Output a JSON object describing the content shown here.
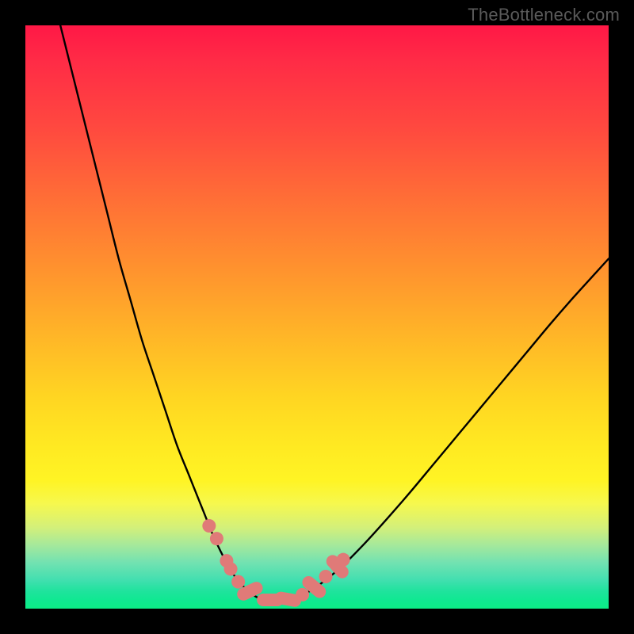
{
  "watermark": {
    "text": "TheBottleneck.com"
  },
  "colors": {
    "frame": "#000000",
    "curve_stroke": "#000000",
    "marker_fill": "#e07a78",
    "marker_stroke": "#d66e6c"
  },
  "chart_data": {
    "type": "line",
    "title": "",
    "xlabel": "",
    "ylabel": "",
    "xlim": [
      0,
      100
    ],
    "ylim": [
      0,
      100
    ],
    "grid": false,
    "legend": false,
    "series": [
      {
        "name": "bottleneck-curve",
        "x": [
          6,
          8,
          10,
          12,
          14,
          16,
          18,
          20,
          22,
          24,
          26,
          28,
          30,
          31,
          32,
          33,
          34,
          35,
          36,
          37,
          38,
          39,
          40,
          41,
          42,
          44,
          46,
          48,
          50,
          54,
          58,
          62,
          66,
          70,
          74,
          78,
          82,
          86,
          90,
          94,
          98,
          100
        ],
        "y": [
          100,
          92,
          84,
          76,
          68,
          60,
          53,
          46,
          40,
          34,
          28,
          23,
          18,
          15.5,
          13,
          10.8,
          8.8,
          7,
          5.4,
          4.2,
          3.2,
          2.4,
          1.8,
          1.4,
          1.3,
          1.4,
          1.8,
          2.6,
          3.8,
          7,
          11,
          15.4,
          20,
          24.8,
          29.6,
          34.4,
          39.2,
          44,
          48.8,
          53.4,
          57.8,
          60
        ]
      }
    ],
    "markers": [
      {
        "x": 31.5,
        "y": 14.2
      },
      {
        "x": 32.8,
        "y": 12.0
      },
      {
        "x": 34.5,
        "y": 8.2
      },
      {
        "x": 35.2,
        "y": 6.8
      },
      {
        "x": 36.5,
        "y": 4.6
      },
      {
        "x": 38.5,
        "y": 3.0,
        "long": true,
        "angle": -25
      },
      {
        "x": 42.0,
        "y": 1.5,
        "long": true,
        "angle": 0
      },
      {
        "x": 45.0,
        "y": 1.6,
        "long": true,
        "angle": 10
      },
      {
        "x": 47.5,
        "y": 2.4
      },
      {
        "x": 49.5,
        "y": 3.7,
        "long": true,
        "angle": 40
      },
      {
        "x": 51.5,
        "y": 5.5
      },
      {
        "x": 53.5,
        "y": 7.2,
        "long": true,
        "angle": 48
      },
      {
        "x": 54.5,
        "y": 8.4
      }
    ]
  }
}
